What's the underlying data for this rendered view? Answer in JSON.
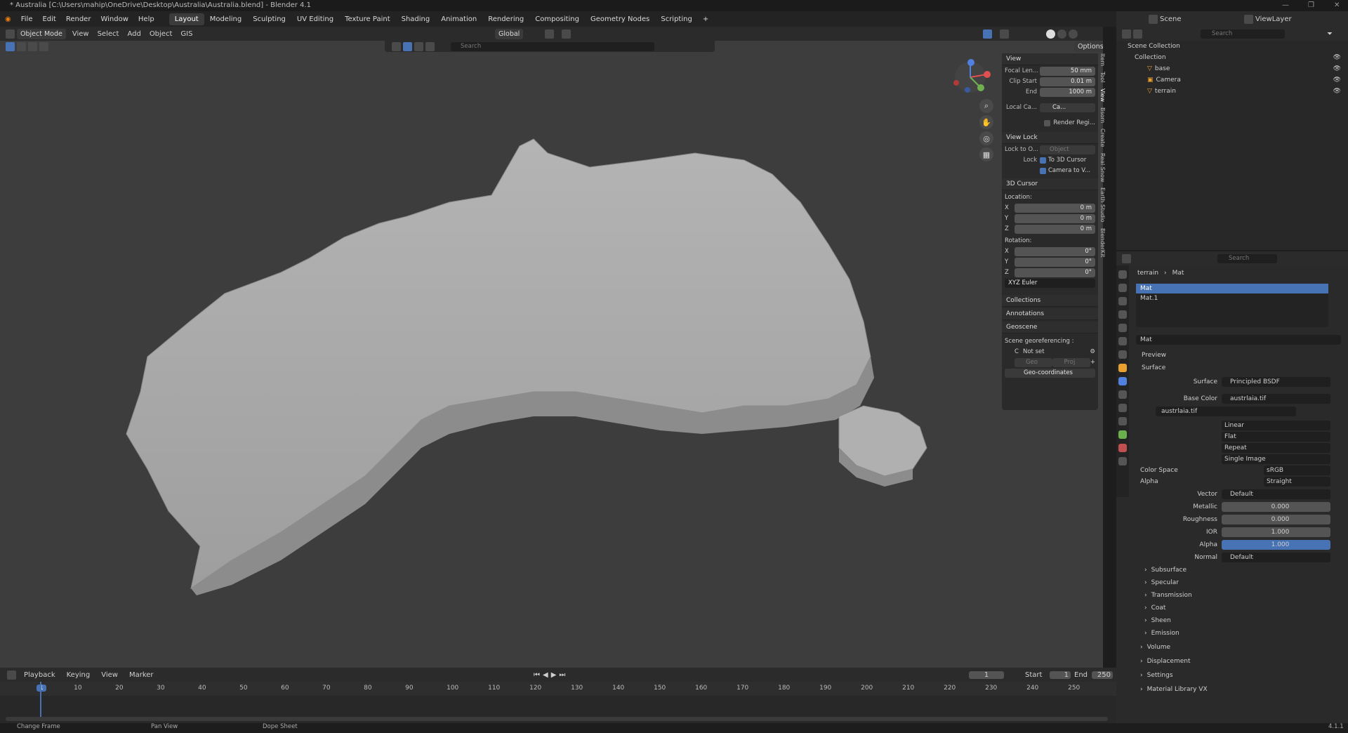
{
  "window": {
    "title": "* Australia [C:\\Users\\mahip\\OneDrive\\Desktop\\Australia\\Australia.blend] - Blender 4.1"
  },
  "menu": {
    "items": [
      "File",
      "Edit",
      "Render",
      "Window",
      "Help"
    ]
  },
  "workspaces": [
    "Layout",
    "Modeling",
    "Sculpting",
    "UV Editing",
    "Texture Paint",
    "Shading",
    "Animation",
    "Rendering",
    "Compositing",
    "Geometry Nodes",
    "Scripting"
  ],
  "top_right": {
    "scene": "Scene",
    "view_layer": "ViewLayer"
  },
  "viewport_header": {
    "mode": "Object Mode",
    "menus": [
      "View",
      "Select",
      "Add",
      "Object",
      "GIS"
    ],
    "orientation": "Global",
    "search_placeholder": "Search",
    "options": "Options"
  },
  "npanel": {
    "view": {
      "title": "View",
      "focal_label": "Focal Len...",
      "focal": "50 mm",
      "clip_start_label": "Clip Start",
      "clip_start": "0.01 m",
      "end_label": "End",
      "end": "1000 m",
      "local_camera_label": "Local Ca...",
      "local_camera": "Ca...",
      "render_region": "Render Regi..."
    },
    "view_lock": {
      "title": "View Lock",
      "lock_to_label": "Lock to O...",
      "lock_to_placeholder": "Object",
      "lock_label": "Lock",
      "to_3d_cursor": "To 3D Cursor",
      "camera_to_view": "Camera to V..."
    },
    "cursor": {
      "title": "3D Cursor",
      "location": "Location:",
      "loc": [
        {
          "axis": "X",
          "val": "0 m"
        },
        {
          "axis": "Y",
          "val": "0 m"
        },
        {
          "axis": "Z",
          "val": "0 m"
        }
      ],
      "rotation": "Rotation:",
      "rot": [
        {
          "axis": "X",
          "val": "0°"
        },
        {
          "axis": "Y",
          "val": "0°"
        },
        {
          "axis": "Z",
          "val": "0°"
        }
      ],
      "mode": "XYZ Euler"
    },
    "collections": "Collections",
    "annotations": "Annotations",
    "geoscene": {
      "title": "Geoscene",
      "georef": "Scene georeferencing :",
      "crs_letter": "C",
      "not_set": "Not set",
      "geo": "Geo",
      "proj": "Proj",
      "geo_coordinates": "Geo-coordinates"
    },
    "side_tabs": [
      "Item",
      "Tool",
      "View",
      "Bsom",
      "Create",
      "Real Snow",
      "Earth Studio",
      "BlenderKit"
    ]
  },
  "outliner": {
    "search_placeholder": "Search",
    "root": "Scene Collection",
    "collection": "Collection",
    "items": [
      "base",
      "Camera",
      "terrain"
    ]
  },
  "properties": {
    "search_placeholder": "Search",
    "breadcrumb": {
      "object": "terrain",
      "material": "Mat"
    },
    "materials": [
      "Mat",
      "Mat.1"
    ],
    "slot_name": "Mat",
    "panels": {
      "preview": "Preview",
      "surface": "Surface"
    },
    "surface_label": "Surface",
    "surface_value": "Principled BSDF",
    "base_color_label": "Base Color",
    "base_color_value": "austrlaia.tif",
    "image_name": "austrlaia.tif",
    "interp": [
      "Linear",
      "Flat",
      "Repeat",
      "Single Image"
    ],
    "color_space_label": "Color Space",
    "color_space": "sRGB",
    "alpha_mode_label": "Alpha",
    "alpha_mode": "Straight",
    "fields": [
      {
        "label": "Vector",
        "value": "Default",
        "type": "link"
      },
      {
        "label": "Metallic",
        "value": "0.000",
        "type": "num"
      },
      {
        "label": "Roughness",
        "value": "0.000",
        "type": "num"
      },
      {
        "label": "IOR",
        "value": "1.000",
        "type": "num"
      },
      {
        "label": "Alpha",
        "value": "1.000",
        "type": "blue"
      },
      {
        "label": "Normal",
        "value": "Default",
        "type": "link"
      }
    ],
    "subpanels": [
      "Subsurface",
      "Specular",
      "Transmission",
      "Coat",
      "Sheen",
      "Emission"
    ],
    "sections": [
      "Volume",
      "Displacement",
      "Settings",
      "Material Library VX"
    ]
  },
  "timeline": {
    "menus": [
      "Playback",
      "Keying",
      "View",
      "Marker"
    ],
    "current_frame": "1",
    "start_label": "Start",
    "start": "1",
    "end_label": "End",
    "end": "250",
    "ticks": [
      "1",
      "10",
      "20",
      "30",
      "40",
      "50",
      "60",
      "70",
      "80",
      "90",
      "100",
      "110",
      "120",
      "130",
      "140",
      "150",
      "160",
      "170",
      "180",
      "190",
      "200",
      "210",
      "220",
      "230",
      "240",
      "250"
    ]
  },
  "status": {
    "items": [
      "Change Frame",
      "Pan View",
      "Dope Sheet"
    ],
    "version": "4.1.1"
  }
}
